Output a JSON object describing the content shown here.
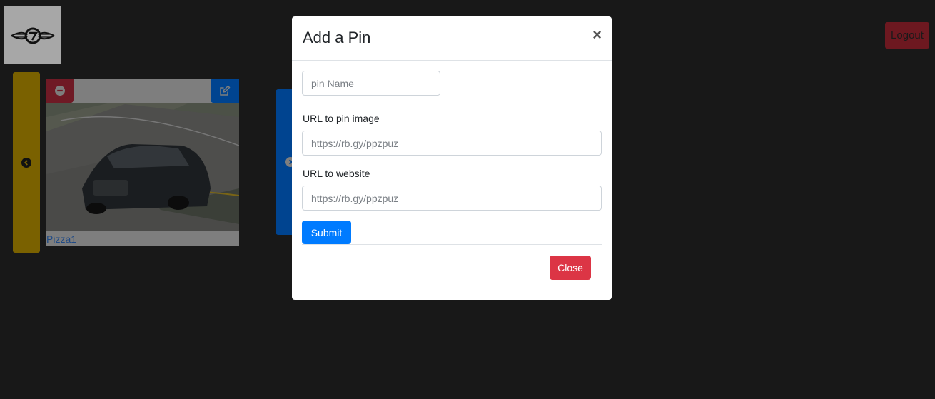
{
  "header": {
    "logout_label": "Logout"
  },
  "pin_card": {
    "label": "Pizza1"
  },
  "modal": {
    "title": "Add a Pin",
    "close_symbol": "×",
    "pin_name": {
      "placeholder": "pin Name",
      "value": ""
    },
    "image_url": {
      "label": "URL to pin image",
      "placeholder": "https://rb.gy/ppzpuz",
      "value": ""
    },
    "website_url": {
      "label": "URL to website",
      "placeholder": "https://rb.gy/ppzpuz",
      "value": ""
    },
    "submit_label": "Submit",
    "close_label": "Close"
  },
  "icons": [
    "logo-icon",
    "chevron-left-icon",
    "chevron-right-icon",
    "minus-circle-icon",
    "edit-icon"
  ],
  "colors": {
    "backdrop": "#181818",
    "primary": "#007bff",
    "danger": "#dc3545",
    "warning_dimmed": "#7a6100"
  }
}
